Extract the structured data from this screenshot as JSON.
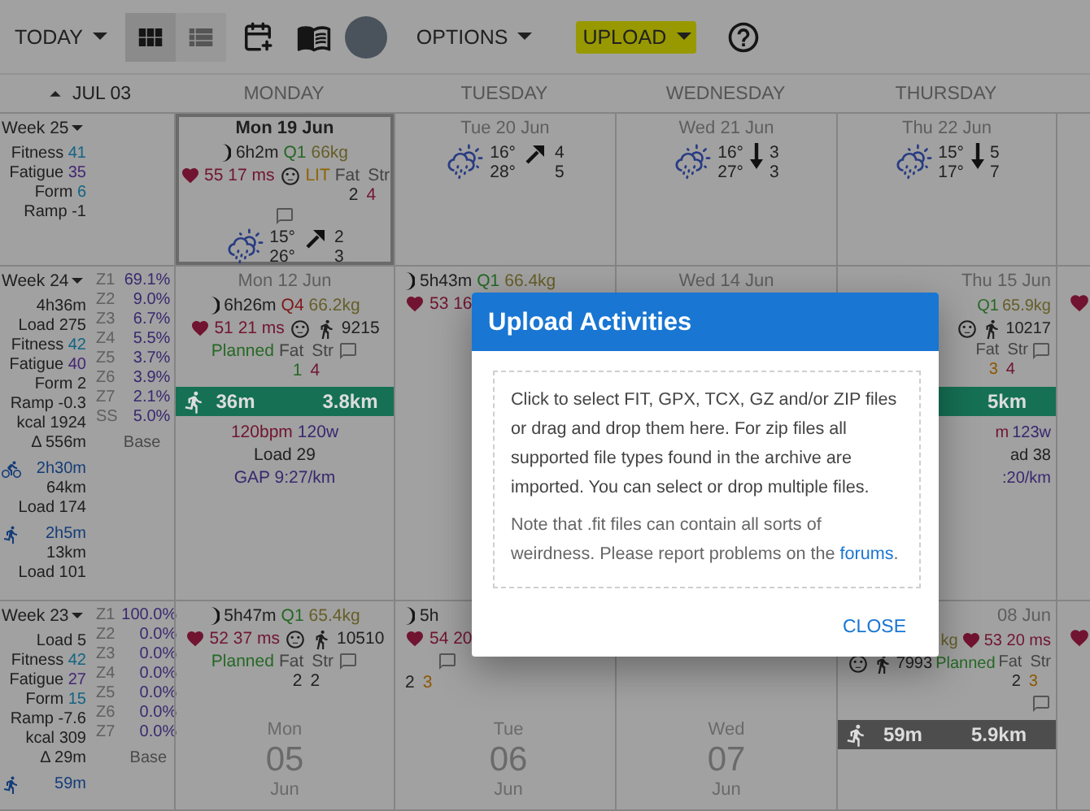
{
  "toolbar": {
    "today": "TODAY",
    "views": [
      {
        "kind": "grid",
        "selected": true
      },
      {
        "kind": "list",
        "selected": false
      }
    ],
    "options": "OPTIONS",
    "upload": {
      "label": "UPLOAD",
      "highlighted": true
    }
  },
  "header": {
    "month": "JUL 03",
    "days": [
      "MONDAY",
      "TUESDAY",
      "WEDNESDAY",
      "THURSDAY"
    ]
  },
  "weeks": [
    {
      "label": "Week 25",
      "stats": [
        {
          "label": "Fitness",
          "value": "41",
          "color": "#136483"
        },
        {
          "label": "Fatigue",
          "value": "35",
          "color": "#432674"
        },
        {
          "label": "Form",
          "value": "6",
          "color": "#136483"
        },
        {
          "label": "Ramp",
          "value": "-1"
        }
      ],
      "days": [
        {
          "kind": "day",
          "date": "Mon 19 Jun",
          "selected": true,
          "lines": [
            {
              "kind": "row",
              "items": [
                {
                  "kind": "moon"
                },
                {
                  "kind": "text",
                  "text": "6h2m"
                },
                {
                  "kind": "text",
                  "text": "Q1",
                  "color": "#256825"
                },
                {
                  "kind": "text",
                  "text": "66kg",
                  "color": "#655e28"
                }
              ]
            },
            {
              "kind": "row",
              "items": [
                {
                  "kind": "heart"
                },
                {
                  "kind": "text",
                  "text": "55 17 ms",
                  "color": "#711431"
                },
                {
                  "kind": "face"
                },
                {
                  "kind": "text",
                  "text": "LIT",
                  "color": "#8d6500"
                },
                {
                  "kind": "fatstr",
                  "labels": [
                    "Fat",
                    "Str"
                  ],
                  "values": [
                    {
                      "text": "2",
                      "color": "#202020"
                    },
                    {
                      "text": "4",
                      "color": "#711431"
                    }
                  ]
                }
              ]
            },
            {
              "kind": "row",
              "items": [
                {
                  "kind": "comment"
                }
              ]
            },
            {
              "kind": "row",
              "items": [
                {
                  "kind": "weather",
                  "top": "15°",
                  "bottom": "26°"
                },
                {
                  "kind": "rising",
                  "values": [
                    "2",
                    "3"
                  ]
                }
              ]
            }
          ]
        },
        {
          "kind": "day",
          "date": "Tue 20 Jun",
          "selected": false,
          "lines": [
            {
              "kind": "row",
              "items": [
                {
                  "kind": "weather",
                  "top": "16°",
                  "bottom": "28°"
                },
                {
                  "kind": "rising",
                  "values": [
                    "4",
                    "5"
                  ]
                }
              ]
            }
          ]
        },
        {
          "kind": "day",
          "date": "Wed 21 Jun",
          "selected": false,
          "lines": [
            {
              "kind": "row",
              "items": [
                {
                  "kind": "weather",
                  "top": "16°",
                  "bottom": "27°"
                },
                {
                  "kind": "falling",
                  "values": [
                    "3",
                    "3"
                  ]
                }
              ]
            }
          ]
        },
        {
          "kind": "day",
          "date": "Thu 22 Jun",
          "selected": false,
          "lines": [
            {
              "kind": "row",
              "items": [
                {
                  "kind": "weather",
                  "top": "15°",
                  "bottom": "17°"
                },
                {
                  "kind": "falling",
                  "values": [
                    "5",
                    "7"
                  ]
                }
              ]
            }
          ]
        }
      ],
      "cut": {
        "heart": false
      }
    },
    {
      "label": "Week 24",
      "stats": [
        {
          "value": "4h36m"
        },
        {
          "label": "Load",
          "value": "275"
        },
        {
          "label": "Fitness",
          "value": "42",
          "color": "#136483"
        },
        {
          "label": "Fatigue",
          "value": "40",
          "color": "#432674"
        },
        {
          "label": "Form",
          "value": "2"
        },
        {
          "label": "Ramp",
          "value": "-0.3"
        },
        {
          "label": "kcal",
          "value": "1924"
        },
        {
          "label": "Δ",
          "value": "556m"
        }
      ],
      "zones": [
        {
          "label": "Z1",
          "value": "69.1%"
        },
        {
          "label": "Z2",
          "value": "9.0%"
        },
        {
          "label": "Z3",
          "value": "6.7%"
        },
        {
          "label": "Z4",
          "value": "5.5%"
        },
        {
          "label": "Z5",
          "value": "3.7%"
        },
        {
          "label": "Z6",
          "value": "3.9%"
        },
        {
          "label": "Z7",
          "value": "2.1%"
        },
        {
          "label": "SS",
          "value": "5.0%"
        }
      ],
      "zones_note": "Base",
      "sports": [
        {
          "kind": "bike",
          "duration": "2h30m",
          "distance": "64km",
          "load": "Load 174"
        },
        {
          "kind": "run",
          "duration": "2h5m",
          "distance": "13km",
          "load": "Load 101"
        }
      ],
      "days": [
        {
          "kind": "day",
          "date": "Mon 12 Jun",
          "selected": false,
          "lines": [
            {
              "kind": "row",
              "items": [
                {
                  "kind": "moon"
                },
                {
                  "kind": "text",
                  "text": "6h26m"
                },
                {
                  "kind": "text",
                  "text": "Q4",
                  "color": "#7d1919"
                },
                {
                  "kind": "text",
                  "text": "66.2kg",
                  "color": "#655e28"
                }
              ]
            },
            {
              "kind": "row",
              "items": [
                {
                  "kind": "heart"
                },
                {
                  "kind": "text",
                  "text": "51 21 ms",
                  "color": "#711431"
                },
                {
                  "kind": "face"
                },
                {
                  "kind": "walker"
                },
                {
                  "kind": "text",
                  "text": "9215"
                }
              ]
            },
            {
              "kind": "row",
              "items": [
                {
                  "kind": "text",
                  "text": "Planned",
                  "color": "#256825"
                },
                {
                  "kind": "fatstr",
                  "labels": [
                    "Fat",
                    "Str"
                  ],
                  "values": [
                    {
                      "text": "1",
                      "color": "#256825"
                    },
                    {
                      "text": "4",
                      "color": "#711431"
                    }
                  ]
                },
                {
                  "kind": "comment"
                }
              ]
            },
            {
              "kind": "run",
              "color": "#157054",
              "items": [
                "36m",
                "3.8km"
              ]
            },
            {
              "kind": "row",
              "items": [
                {
                  "kind": "text",
                  "text": "120bpm",
                  "color": "#711431"
                },
                {
                  "kind": "text",
                  "text": "120w",
                  "color": "#39286f"
                }
              ]
            },
            {
              "kind": "row",
              "items": [
                {
                  "kind": "text",
                  "text": "Load 29"
                }
              ]
            },
            {
              "kind": "row",
              "items": [
                {
                  "kind": "text",
                  "text": "GAP 9:27/km",
                  "color": "#39286f"
                }
              ]
            }
          ]
        },
        {
          "kind": "cut-left",
          "selected": false,
          "lines": [
            {
              "kind": "row",
              "items": [
                {
                  "kind": "moon"
                },
                {
                  "kind": "text",
                  "text": "5h43m"
                },
                {
                  "kind": "text",
                  "text": "Q1",
                  "color": "#256825"
                },
                {
                  "kind": "text",
                  "text": "66.4kg",
                  "color": "#655e28"
                }
              ]
            },
            {
              "kind": "row",
              "items": [
                {
                  "kind": "heart"
                },
                {
                  "kind": "text",
                  "text": "53 16",
                  "color": "#711431"
                }
              ]
            }
          ]
        },
        {
          "kind": "day",
          "date": "Wed 14 Jun",
          "selected": false
        },
        {
          "kind": "cut-right",
          "date": "Thu 15 Jun",
          "selected": false,
          "lines": [
            {
              "kind": "row",
              "items": [
                {
                  "kind": "text",
                  "text": "Q1",
                  "color": "#256825"
                },
                {
                  "kind": "text",
                  "text": "65.9kg",
                  "color": "#655e28"
                }
              ]
            },
            {
              "kind": "row",
              "items": [
                {
                  "kind": "face"
                },
                {
                  "kind": "walker"
                },
                {
                  "kind": "text",
                  "text": "10217"
                }
              ]
            },
            {
              "kind": "row",
              "items": [
                {
                  "kind": "fatstr",
                  "labels": [
                    "Fat",
                    "Str"
                  ],
                  "values": [
                    {
                      "text": "3",
                      "color": "#8d5700"
                    },
                    {
                      "text": "4",
                      "color": "#711431"
                    }
                  ]
                },
                {
                  "kind": "comment"
                }
              ]
            },
            {
              "kind": "bar",
              "color": "#157054",
              "items": [
                "5km"
              ]
            },
            {
              "kind": "row",
              "items": [
                {
                  "kind": "text",
                  "text": "m",
                  "color": "#711431"
                },
                {
                  "kind": "text",
                  "text": "123w",
                  "color": "#39286f"
                }
              ]
            },
            {
              "kind": "row",
              "items": [
                {
                  "kind": "text",
                  "text": "ad 38"
                }
              ]
            },
            {
              "kind": "row",
              "items": [
                {
                  "kind": "text",
                  "text": ":20/km",
                  "color": "#39286f"
                }
              ]
            }
          ]
        }
      ],
      "cut": {
        "heart": true
      }
    },
    {
      "label": "Week 23",
      "stats": [
        {
          "label": "Load",
          "value": "5"
        },
        {
          "label": "Fitness",
          "value": "42",
          "color": "#136483"
        },
        {
          "label": "Fatigue",
          "value": "27",
          "color": "#432674"
        },
        {
          "label": "Form",
          "value": "15",
          "color": "#136483"
        },
        {
          "label": "Ramp",
          "value": "-7.6"
        },
        {
          "label": "kcal",
          "value": "309"
        },
        {
          "label": "Δ",
          "value": "29m"
        }
      ],
      "zones": [
        {
          "label": "Z1",
          "value": "100.0%"
        },
        {
          "label": "Z2",
          "value": "0.0%"
        },
        {
          "label": "Z3",
          "value": "0.0%"
        },
        {
          "label": "Z4",
          "value": "0.0%"
        },
        {
          "label": "Z5",
          "value": "0.0%"
        },
        {
          "label": "Z6",
          "value": "0.0%"
        },
        {
          "label": "Z7",
          "value": "0.0%"
        }
      ],
      "zones_note": "Base",
      "sports": [
        {
          "kind": "run",
          "duration": "59m"
        }
      ],
      "days": [
        {
          "kind": "day",
          "selected": false,
          "lines": [
            {
              "kind": "row",
              "items": [
                {
                  "kind": "moon"
                },
                {
                  "kind": "text",
                  "text": "5h47m"
                },
                {
                  "kind": "text",
                  "text": "Q1",
                  "color": "#256825"
                },
                {
                  "kind": "text",
                  "text": "65.4kg",
                  "color": "#655e28"
                }
              ]
            },
            {
              "kind": "row",
              "items": [
                {
                  "kind": "heart"
                },
                {
                  "kind": "text",
                  "text": "52 37 ms",
                  "color": "#711431"
                },
                {
                  "kind": "face"
                },
                {
                  "kind": "walker"
                },
                {
                  "kind": "text",
                  "text": "10510"
                }
              ]
            },
            {
              "kind": "row",
              "items": [
                {
                  "kind": "text",
                  "text": "Planned",
                  "color": "#256825"
                },
                {
                  "kind": "fatstr",
                  "labels": [
                    "Fat",
                    "Str"
                  ],
                  "values": [
                    {
                      "text": "2",
                      "color": "#202020"
                    },
                    {
                      "text": "2",
                      "color": "#202020"
                    }
                  ]
                },
                {
                  "kind": "comment"
                }
              ]
            }
          ],
          "footer": {
            "weekday": "Mon",
            "day": "05",
            "month": "Jun"
          }
        },
        {
          "kind": "cut-left",
          "selected": false,
          "lines": [
            {
              "kind": "row",
              "items": [
                {
                  "kind": "moon"
                },
                {
                  "kind": "text",
                  "text": "5h"
                }
              ]
            },
            {
              "kind": "row",
              "items": [
                {
                  "kind": "heart"
                },
                {
                  "kind": "text",
                  "text": "54 20",
                  "color": "#711431"
                }
              ]
            },
            {
              "kind": "row",
              "items": [
                {
                  "kind": "fatstr",
                  "values": [
                    {
                      "text": "2",
                      "color": "#202020"
                    },
                    {
                      "text": "3",
                      "color": "#8d5700"
                    }
                  ]
                },
                {
                  "kind": "comment"
                }
              ]
            }
          ],
          "footer": {
            "weekday": "Tue",
            "day": "06",
            "month": "Jun"
          }
        },
        {
          "kind": "day",
          "selected": false,
          "footer": {
            "weekday": "Wed",
            "day": "07",
            "month": "Jun"
          }
        },
        {
          "kind": "cut-right",
          "date": "08 Jun",
          "selected": false,
          "lines": [
            {
              "kind": "row",
              "items": [
                {
                  "kind": "text",
                  "text": "kg",
                  "color": "#655e28"
                },
                {
                  "kind": "heart"
                },
                {
                  "kind": "text",
                  "text": "53 20 ms",
                  "color": "#711431"
                }
              ]
            },
            {
              "kind": "row",
              "items": [
                {
                  "kind": "face"
                },
                {
                  "kind": "walker"
                },
                {
                  "kind": "text",
                  "text": "7993"
                },
                {
                  "kind": "text",
                  "text": "Planned",
                  "color": "#256825"
                },
                {
                  "kind": "fatstr",
                  "labels": [
                    "Fat",
                    "Str"
                  ],
                  "values": [
                    {
                      "text": "2",
                      "color": "#202020"
                    },
                    {
                      "text": "3",
                      "color": "#8d5700"
                    }
                  ]
                }
              ]
            },
            {
              "kind": "row",
              "items": [
                {
                  "kind": "comment"
                }
              ]
            },
            {
              "kind": "run",
              "color": "#4d4d4d",
              "items": [
                "59m",
                "5.9km"
              ]
            }
          ]
        }
      ],
      "cut": {
        "heart": true
      }
    }
  ],
  "dialog": {
    "title": "Upload Activities",
    "paragraphs": [
      {
        "text": "Click to select FIT, GPX, TCX, GZ and/or ZIP files or drag and drop them here. For zip files all supported file types found in the archive are imported. You can select or drop multiple files."
      },
      {
        "text": "Note that .fit files can contain all sorts of weirdness. Please report problems on the ",
        "link": "forums",
        "after": "."
      }
    ],
    "button": "CLOSE"
  }
}
